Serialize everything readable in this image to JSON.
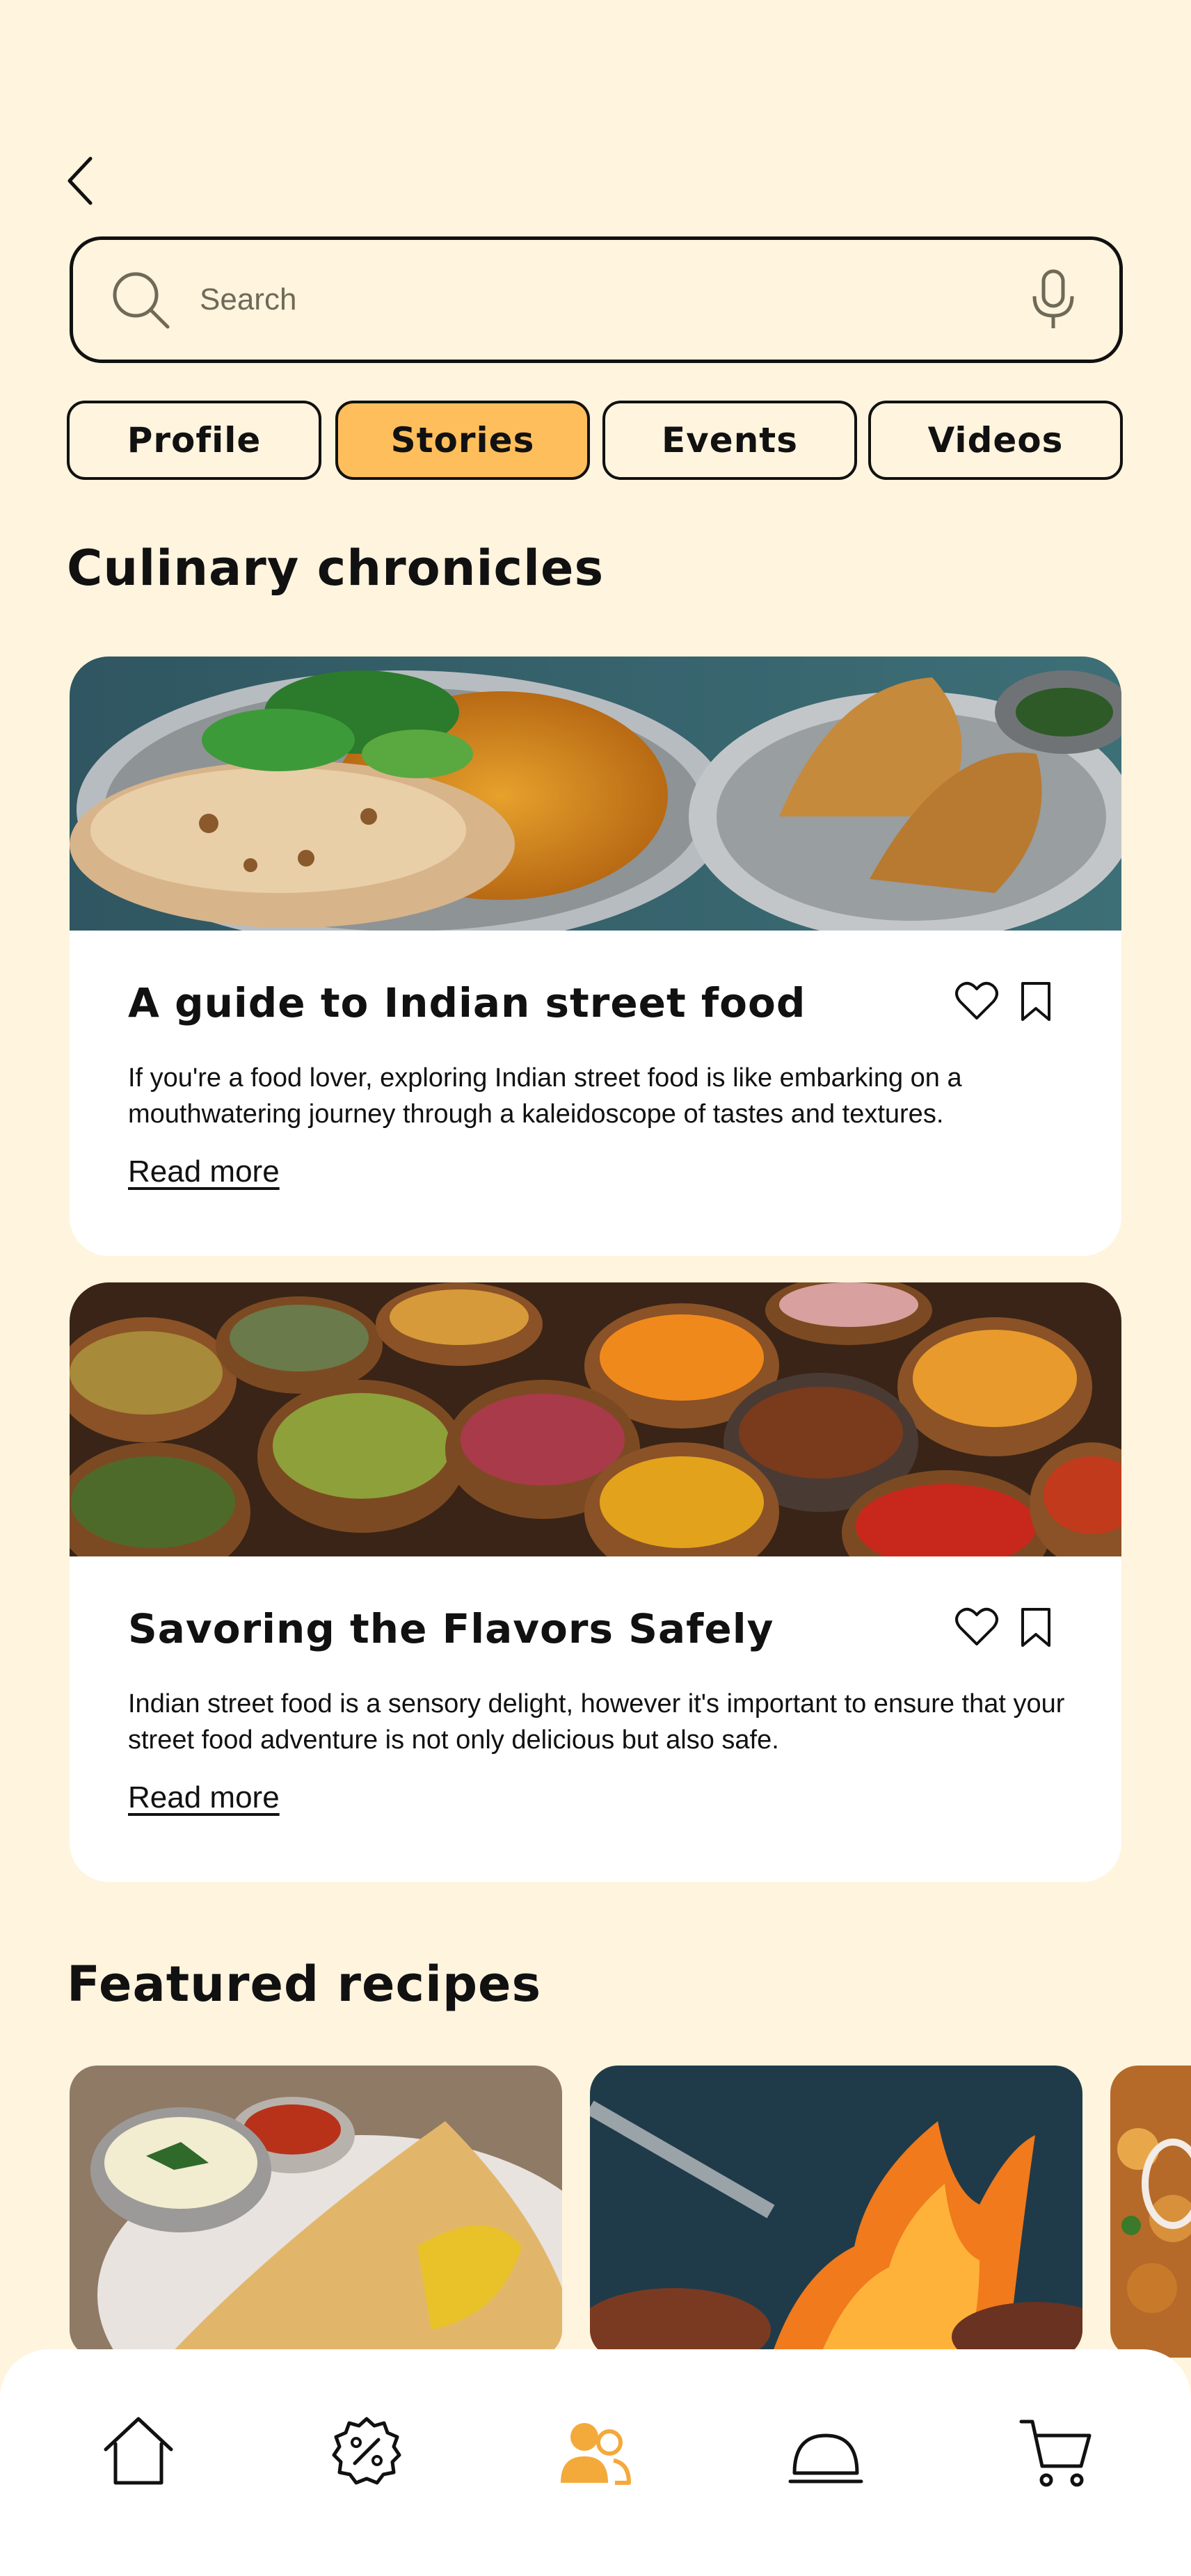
{
  "search": {
    "placeholder": "Search"
  },
  "tabs": [
    {
      "label": "Profile",
      "active": false
    },
    {
      "label": "Stories",
      "active": true
    },
    {
      "label": "Events",
      "active": false
    },
    {
      "label": "Videos",
      "active": false
    }
  ],
  "sections": {
    "chronicles_title": "Culinary chronicles",
    "featured_title": "Featured recipes"
  },
  "stories": [
    {
      "title": "A guide to Indian street food",
      "description": "If you're a food lover, exploring Indian street food is like embarking on a mouthwatering journey through a kaleidoscope of tastes and textures.",
      "read_more": "Read more",
      "image": "paratha-and-samosa-photo"
    },
    {
      "title": "Savoring the Flavors Safely",
      "description": "Indian street food is a sensory delight, however it's important to ensure that your street food adventure is not only delicious but also safe.",
      "read_more": "Read more",
      "image": "spice-bowls-photo"
    }
  ],
  "recipes": [
    {
      "image": "dosa-with-chutney-photo"
    },
    {
      "image": "grilled-kebab-flames-photo"
    },
    {
      "image": "biryani-photo"
    }
  ],
  "nav": {
    "items": [
      "home-icon",
      "offers-icon",
      "community-icon",
      "dish-icon",
      "cart-icon"
    ],
    "active": "community-icon",
    "active_color": "#F4A93B"
  },
  "colors": {
    "background": "#FFF4DE",
    "accent": "#FFBE5C"
  }
}
